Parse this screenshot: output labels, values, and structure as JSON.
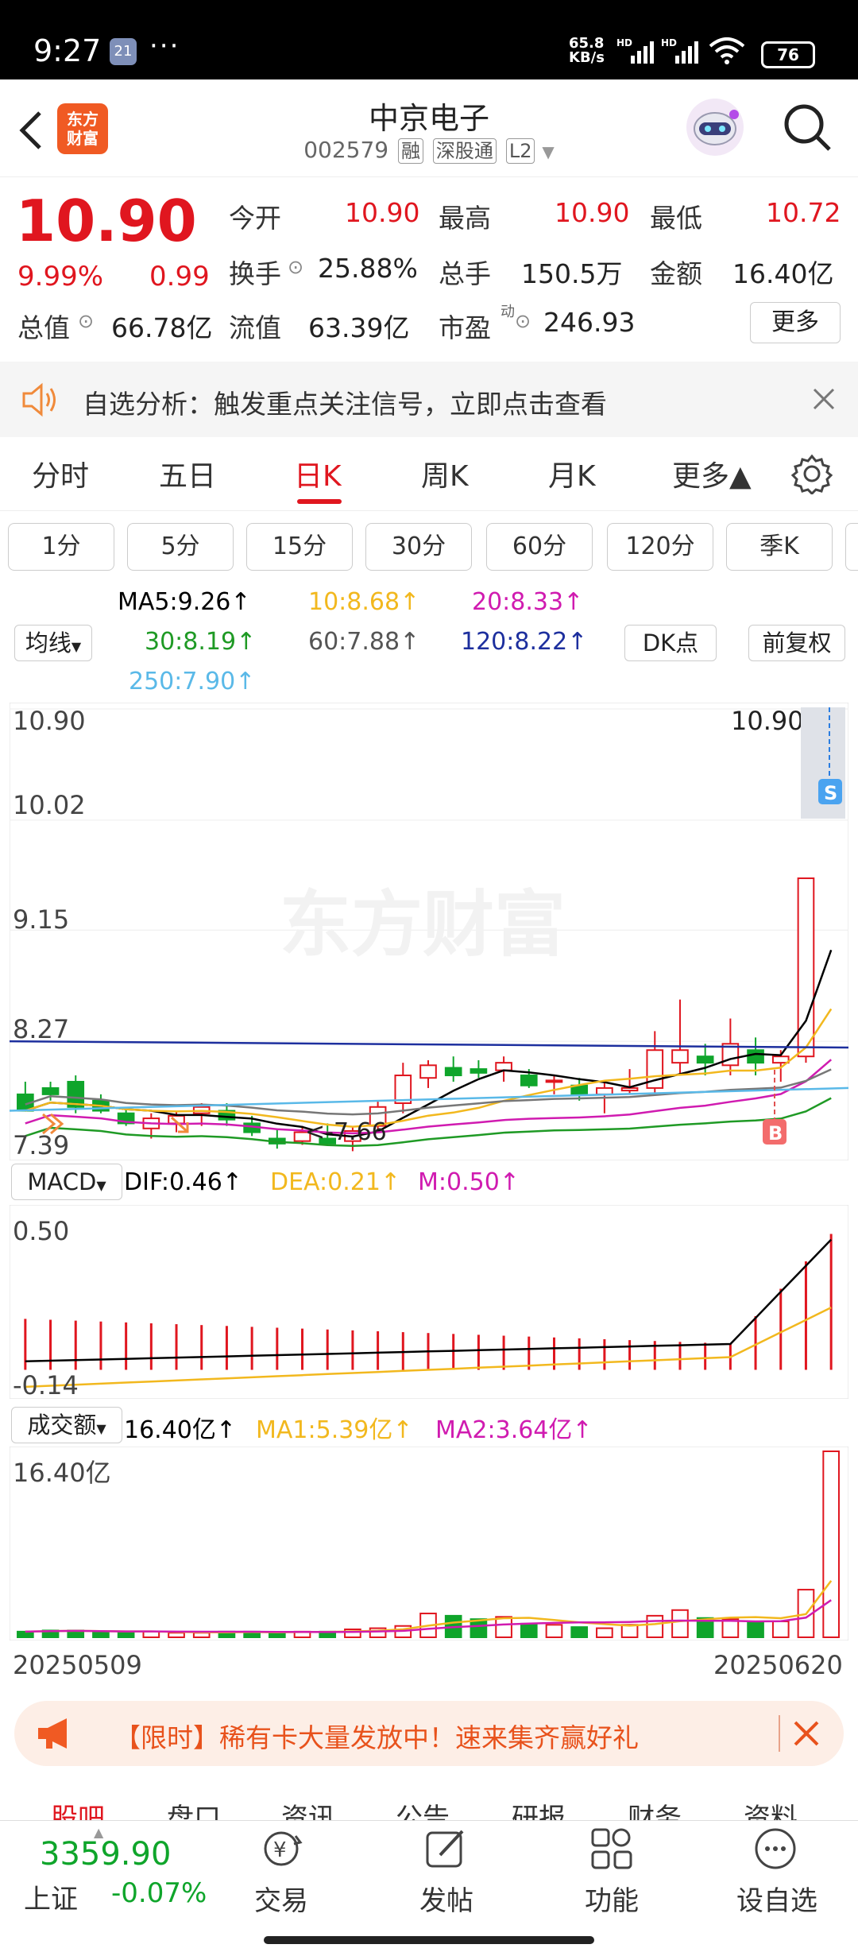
{
  "status_bar": {
    "time": "9:27",
    "notif_badge": "21",
    "more": "···",
    "net_speed": "65.8",
    "net_unit": "KB/s",
    "battery": "76"
  },
  "header": {
    "logo_text_line1": "东方",
    "logo_text_line2": "财富",
    "stock_name": "中京电子",
    "stock_code": "002579",
    "tags": [
      "融",
      "深股通",
      "L2"
    ]
  },
  "quote": {
    "price": "10.90",
    "change_pct": "9.99%",
    "change": "0.99",
    "open_label": "今开",
    "open": "10.90",
    "high_label": "最高",
    "high": "10.90",
    "low_label": "最低",
    "low": "10.72",
    "turnover_label": "换手",
    "turnover": "25.88%",
    "volume_label": "总手",
    "volume": "150.5万",
    "amount_label": "金额",
    "amount": "16.40亿",
    "mktcap_label": "总值",
    "mktcap": "66.78亿",
    "float_label": "流值",
    "float": "63.39亿",
    "pe_label": "市盈",
    "pe_sup": "动",
    "pe": "246.93",
    "more_btn": "更多"
  },
  "notice": {
    "text": "自选分析：触发重点关注信号，立即点击查看"
  },
  "tabs": [
    "分时",
    "五日",
    "日K",
    "周K",
    "月K",
    "更多▲"
  ],
  "active_tab": 2,
  "period_chips": [
    "1分",
    "5分",
    "15分",
    "30分",
    "60分",
    "120分",
    "季K"
  ],
  "ma_bar": {
    "selector": "均线",
    "ma5": "MA5:9.26↑",
    "ma10": "10:8.68↑",
    "ma20": "20:8.33↑",
    "ma30": "30:8.19↑",
    "ma60": "60:7.88↑",
    "ma120": "120:8.22↑",
    "ma250": "250:7.90↑",
    "dk_btn": "DK点",
    "adj_btn": "前复权"
  },
  "colors": {
    "up": "#e0161f",
    "down": "#0fa52b",
    "ma5": "#000000",
    "ma10": "#f2b81e",
    "ma20": "#d01bb0",
    "ma30": "#1f9a25",
    "ma60": "#777777",
    "ma120": "#1d2f9e",
    "ma250": "#5ab9e8"
  },
  "kline": {
    "y_ticks": [
      "10.90",
      "10.02",
      "9.15",
      "8.27",
      "7.39"
    ],
    "last_price_label": "10.90->",
    "low_label": "<-7.66",
    "watermark": "东方财富",
    "sell_marker": "S",
    "buy_marker": "B"
  },
  "macd": {
    "selector": "MACD",
    "dif": "DIF:0.46↑",
    "dea": "DEA:0.21↑",
    "m": "M:0.50↑",
    "y_ticks": [
      "0.50",
      "-0.14"
    ]
  },
  "volume": {
    "selector": "成交额",
    "value": "16.40亿↑",
    "ma1": "MA1:5.39亿↑",
    "ma2": "MA2:3.64亿↑",
    "y_tick": "16.40亿",
    "date_start": "20250509",
    "date_end": "20250620"
  },
  "promo": {
    "text": "【限时】稀有卡大量发放中！速来集齐赢好礼"
  },
  "sub_tabs": [
    "股吧",
    "盘口",
    "资讯",
    "公告",
    "研报",
    "财务",
    "资料"
  ],
  "bottom_bar": {
    "index_value": "3359.90",
    "index_name": "上证",
    "index_change": "-0.07%",
    "nav": [
      "交易",
      "发帖",
      "功能",
      "设自选"
    ]
  },
  "chart_data": {
    "type": "candlestick",
    "dates": [
      "20250509",
      "20250620"
    ],
    "ohlc": [
      [
        7.85,
        7.95,
        7.8,
        7.72
      ],
      [
        7.9,
        7.95,
        7.8,
        7.85
      ],
      [
        7.95,
        8.0,
        7.7,
        7.75
      ],
      [
        7.8,
        7.85,
        7.7,
        7.72
      ],
      [
        7.7,
        7.75,
        7.6,
        7.62
      ],
      [
        7.58,
        7.7,
        7.5,
        7.66
      ],
      [
        7.62,
        7.72,
        7.55,
        7.68
      ],
      [
        7.7,
        7.78,
        7.6,
        7.75
      ],
      [
        7.72,
        7.78,
        7.6,
        7.65
      ],
      [
        7.62,
        7.68,
        7.52,
        7.55
      ],
      [
        7.5,
        7.58,
        7.42,
        7.46
      ],
      [
        7.48,
        7.6,
        7.45,
        7.55
      ],
      [
        7.5,
        7.62,
        7.45,
        7.46
      ],
      [
        7.48,
        7.6,
        7.4,
        7.56
      ],
      [
        7.6,
        7.8,
        7.55,
        7.75
      ],
      [
        7.78,
        8.1,
        7.7,
        8.0
      ],
      [
        7.98,
        8.12,
        7.9,
        8.08
      ],
      [
        8.06,
        8.15,
        7.95,
        8.0
      ],
      [
        8.05,
        8.12,
        7.98,
        8.02
      ],
      [
        8.04,
        8.15,
        7.95,
        8.1
      ],
      [
        8.0,
        8.05,
        7.9,
        7.92
      ],
      [
        7.95,
        8.0,
        7.85,
        7.96
      ],
      [
        7.92,
        7.98,
        7.8,
        7.85
      ],
      [
        7.85,
        7.95,
        7.7,
        7.9
      ],
      [
        7.88,
        8.05,
        7.85,
        7.9
      ],
      [
        7.9,
        8.35,
        7.85,
        8.2
      ],
      [
        8.1,
        8.6,
        8.0,
        8.2
      ],
      [
        8.15,
        8.25,
        8.0,
        8.1
      ],
      [
        8.08,
        8.45,
        8.0,
        8.25
      ],
      [
        8.2,
        8.3,
        8.0,
        8.1
      ],
      [
        8.1,
        8.2,
        7.95,
        8.15
      ],
      [
        8.15,
        9.56,
        8.1,
        9.56
      ],
      [
        10.52,
        10.9,
        10.48,
        10.9
      ]
    ],
    "y_range": [
      7.39,
      10.9
    ]
  }
}
